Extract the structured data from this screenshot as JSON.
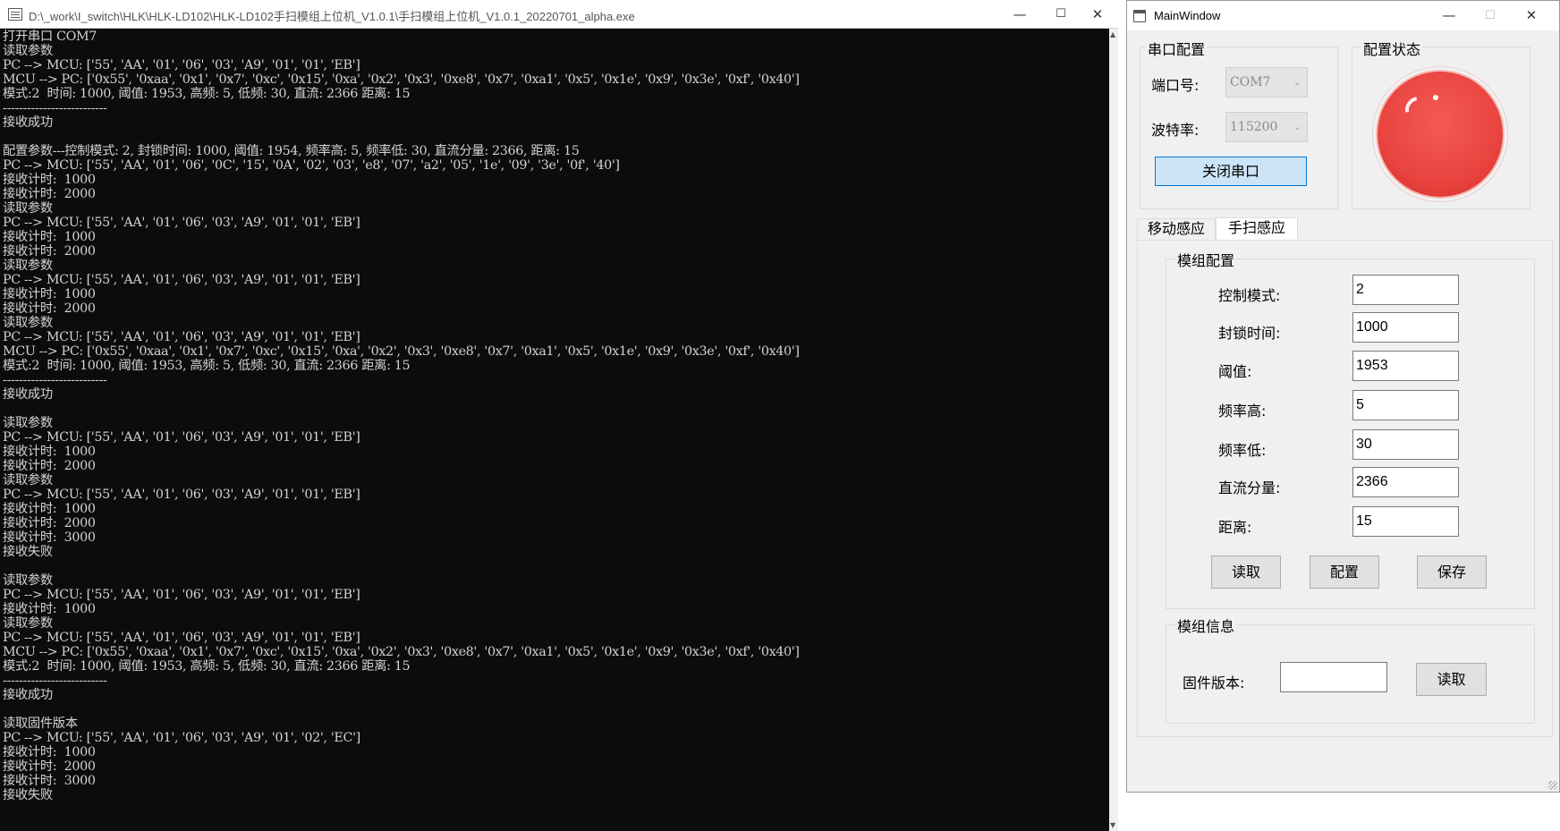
{
  "console": {
    "title": "D:\\_work\\I_switch\\HLK\\HLK-LD102\\HLK-LD102手扫模组上位机_V1.0.1\\手扫模组上位机_V1.0.1_20220701_alpha.exe",
    "lines": [
      "打开串口 COM7",
      "读取参数",
      "PC --> MCU: ['55', 'AA', '01', '06', '03', 'A9', '01', '01', 'EB']",
      "MCU --> PC: ['0x55', '0xaa', '0x1', '0x7', '0xc', '0x15', '0xa', '0x2', '0x3', '0xe8', '0x7', '0xa1', '0x5', '0x1e', '0x9', '0x3e', '0xf', '0x40']",
      "模式:2  时间: 1000, 阈值: 1953, 高频: 5, 低频: 30, 直流: 2366 距离: 15",
      "--------------------------",
      "接收成功",
      "",
      "配置参数---控制模式: 2, 封锁时间: 1000, 阈值: 1954, 频率高: 5, 频率低: 30, 直流分量: 2366, 距离: 15",
      "PC --> MCU: ['55', 'AA', '01', '06', '0C', '15', '0A', '02', '03', 'e8', '07', 'a2', '05', '1e', '09', '3e', '0f', '40']",
      "接收计时:  1000",
      "接收计时:  2000",
      "读取参数",
      "PC --> MCU: ['55', 'AA', '01', '06', '03', 'A9', '01', '01', 'EB']",
      "接收计时:  1000",
      "接收计时:  2000",
      "读取参数",
      "PC --> MCU: ['55', 'AA', '01', '06', '03', 'A9', '01', '01', 'EB']",
      "接收计时:  1000",
      "接收计时:  2000",
      "读取参数",
      "PC --> MCU: ['55', 'AA', '01', '06', '03', 'A9', '01', '01', 'EB']",
      "MCU --> PC: ['0x55', '0xaa', '0x1', '0x7', '0xc', '0x15', '0xa', '0x2', '0x3', '0xe8', '0x7', '0xa1', '0x5', '0x1e', '0x9', '0x3e', '0xf', '0x40']",
      "模式:2  时间: 1000, 阈值: 1953, 高频: 5, 低频: 30, 直流: 2366 距离: 15",
      "--------------------------",
      "接收成功",
      "",
      "读取参数",
      "PC --> MCU: ['55', 'AA', '01', '06', '03', 'A9', '01', '01', 'EB']",
      "接收计时:  1000",
      "接收计时:  2000",
      "读取参数",
      "PC --> MCU: ['55', 'AA', '01', '06', '03', 'A9', '01', '01', 'EB']",
      "接收计时:  1000",
      "接收计时:  2000",
      "接收计时:  3000",
      "接收失败",
      "",
      "读取参数",
      "PC --> MCU: ['55', 'AA', '01', '06', '03', 'A9', '01', '01', 'EB']",
      "接收计时:  1000",
      "读取参数",
      "PC --> MCU: ['55', 'AA', '01', '06', '03', 'A9', '01', '01', 'EB']",
      "MCU --> PC: ['0x55', '0xaa', '0x1', '0x7', '0xc', '0x15', '0xa', '0x2', '0x3', '0xe8', '0x7', '0xa1', '0x5', '0x1e', '0x9', '0x3e', '0xf', '0x40']",
      "模式:2  时间: 1000, 阈值: 1953, 高频: 5, 低频: 30, 直流: 2366 距离: 15",
      "--------------------------",
      "接收成功",
      "",
      "读取固件版本",
      "PC --> MCU: ['55', 'AA', '01', '06', '03', 'A9', '01', '02', 'EC']",
      "接收计时:  1000",
      "接收计时:  2000",
      "接收计时:  3000",
      "接收失败"
    ]
  },
  "main": {
    "title": "MainWindow",
    "serial_group": {
      "title": "串口配置",
      "port_label": "端口号:",
      "port_value": "COM7",
      "baud_label": "波特率:",
      "baud_value": "115200",
      "close_button": "关闭串口"
    },
    "status_group": {
      "title": "配置状态",
      "status_color": "#e8443f"
    },
    "tabs": [
      {
        "label": "移动感应",
        "active": false
      },
      {
        "label": "手扫感应",
        "active": true
      }
    ],
    "module_config": {
      "title": "模组配置",
      "fields": [
        {
          "label": "控制模式:",
          "value": "2"
        },
        {
          "label": "封锁时间:",
          "value": "1000"
        },
        {
          "label": "阈值:",
          "value": "1953"
        },
        {
          "label": "频率高:",
          "value": "5"
        },
        {
          "label": "频率低:",
          "value": "30"
        },
        {
          "label": "直流分量:",
          "value": "2366"
        },
        {
          "label": "距离:",
          "value": "15"
        }
      ],
      "read_button": "读取",
      "config_button": "配置",
      "save_button": "保存"
    },
    "module_info": {
      "title": "模组信息",
      "firmware_label": "固件版本:",
      "firmware_value": "",
      "read_button": "读取"
    }
  }
}
